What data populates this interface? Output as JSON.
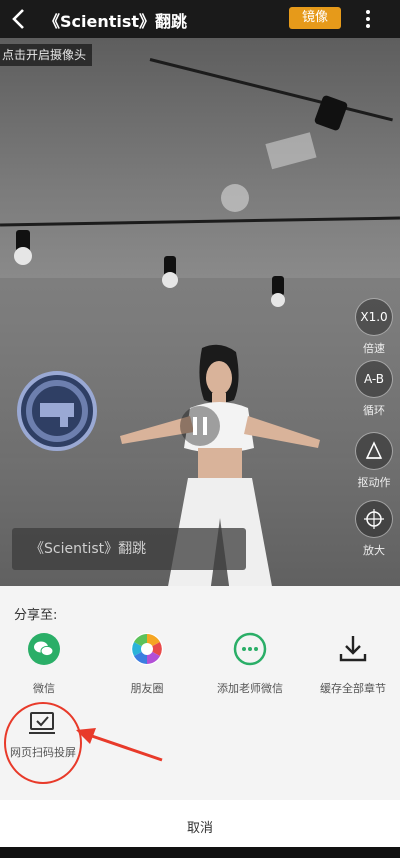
{
  "header": {
    "title": "《Scientist》翻跳",
    "mirror_label": "镜像",
    "camera_hint": "点击开启摄像头"
  },
  "video": {
    "caption": "《Scientist》翻跳",
    "side_controls": [
      {
        "icon_text": "X1.0",
        "label": "倍速",
        "icon": "speed-icon"
      },
      {
        "icon_text": "A-B",
        "label": "循环",
        "icon": "loop-icon"
      },
      {
        "icon_text": "",
        "label": "抠动作",
        "icon": "cutout-icon"
      },
      {
        "icon_text": "",
        "label": "放大",
        "icon": "zoom-icon"
      }
    ]
  },
  "share_sheet": {
    "title": "分享至:",
    "items": [
      {
        "label": "微信",
        "icon": "wechat-icon",
        "color": "#2aae67"
      },
      {
        "label": "朋友圈",
        "icon": "moments-icon",
        "color": "#f5a623"
      },
      {
        "label": "添加老师微信",
        "icon": "chat-bubble-icon",
        "color": "#2aae67"
      },
      {
        "label": "缓存全部章节",
        "icon": "download-icon",
        "color": "#222222"
      }
    ],
    "cast": {
      "label": "网页扫码投屏",
      "icon": "cast-screen-icon"
    },
    "cancel_label": "取消"
  },
  "colors": {
    "accent_orange": "#e69a1a",
    "highlight_red": "#e83a2a"
  }
}
